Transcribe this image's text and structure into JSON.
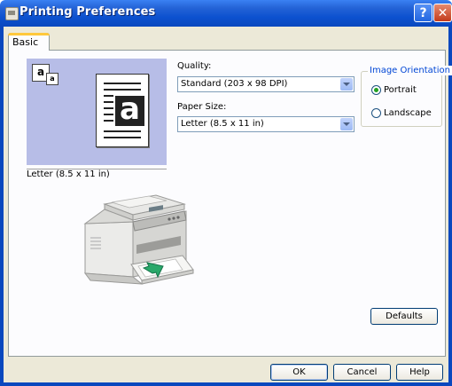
{
  "window": {
    "title": "Printing Preferences",
    "help_glyph": "?",
    "close_glyph": "✕"
  },
  "tabs": [
    {
      "label": "Basic",
      "active": true
    }
  ],
  "preview": {
    "orientation_icon_big": "a",
    "orientation_icon_small": "a",
    "page_letter": "a",
    "caption": "Letter (8.5 x 11 in)"
  },
  "quality": {
    "label": "Quality:",
    "value": "Standard (203 x 98 DPI)"
  },
  "paper_size": {
    "label": "Paper Size:",
    "value": "Letter (8.5 x 11 in)"
  },
  "orientation": {
    "title": "Image Orientation",
    "options": [
      {
        "label": "Portrait",
        "selected": true
      },
      {
        "label": "Landscape",
        "selected": false
      }
    ]
  },
  "buttons": {
    "defaults": "Defaults",
    "ok": "OK",
    "cancel": "Cancel",
    "help": "Help"
  },
  "colors": {
    "title_bar": "#0c51cf",
    "preview_bg": "#b7bde7",
    "dialog_bg": "#ece9d8",
    "group_title": "#0046d5",
    "arrow_green": "#2aa86a"
  }
}
